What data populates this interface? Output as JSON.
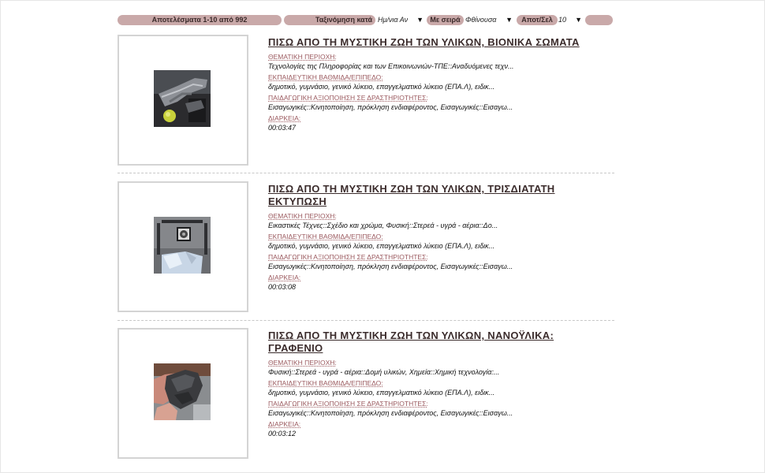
{
  "controls": {
    "results_label": "Αποτελέσματα 1-10 από 992",
    "sort_label": "Ταξινόμηση κατά",
    "sort_value": "Ημ/νια Αν",
    "order_label": "Με σειρά",
    "order_value": "Φθίνουσα",
    "perpage_label": "Αποτ/Σελ",
    "perpage_value": "10",
    "arrow": "▼"
  },
  "labels": {
    "subject": "ΘΕΜΑΤΙΚΗ ΠΕΡΙΟΧΗ:",
    "level": "ΕΚΠΑΙΔΕΥΤΙΚΗ ΒΑΘΜΙΔΑ/ΕΠΙΠΕΔΟ:",
    "use": "ΠΑΙΔΑΓΩΓΙΚΗ ΑΞΙΟΠΟΙΗΣΗ ΣΕ ΔΡΑΣΤΗΡΙΟΤΗΤΕΣ:",
    "duration": "ΔΙΑΡΚΕΙΑ:"
  },
  "results": [
    {
      "title": "ΠΙΣΩ ΑΠΟ ΤΗ ΜΥΣΤΙΚΗ ΖΩΗ ΤΩΝ ΥΛΙΚΩΝ, ΒΙΟΝΙΚΑ ΣΩΜΑΤΑ",
      "subject": "Τεχνολογίες της Πληροφορίας και των Επικοινωνιών-ΤΠΕ::Αναδυόμενες τεχν...",
      "level": "δημοτικό, γυμνάσιο, γενικό λύκειο, επαγγελματικό λύκειο (ΕΠΑ.Λ), ειδικ...",
      "use": "Εισαγωγικές::Κινητοποίηση, πρόκληση ενδιαφέροντος, Εισαγωγικές::Εισαγω...",
      "duration": "00:03:47",
      "thumb_icon": "robotic-hand-thumbnail"
    },
    {
      "title": "ΠΙΣΩ ΑΠΟ ΤΗ ΜΥΣΤΙΚΗ ΖΩΗ ΤΩΝ ΥΛΙΚΩΝ, ΤΡΙΣΔΙΑΤΑΤΗ ΕΚΤΥΠΩΣΗ",
      "subject": "Εικαστικές Τέχνες::Σχέδιο και χρώμα, Φυσική::Στερεά - υγρά - αέρια::Δο...",
      "level": "δημοτικό, γυμνάσιο, γενικό λύκειο, επαγγελματικό λύκειο (ΕΠΑ.Λ), ειδικ...",
      "use": "Εισαγωγικές::Κινητοποίηση, πρόκληση ενδιαφέροντος, Εισαγωγικές::Εισαγω...",
      "duration": "00:03:08",
      "thumb_icon": "3d-printer-thumbnail"
    },
    {
      "title": "ΠΙΣΩ ΑΠΟ ΤΗ ΜΥΣΤΙΚΗ ΖΩΗ ΤΩΝ ΥΛΙΚΩΝ, ΝΑΝΟΫΛΙΚΑ: ΓΡΑΦΕΝΙΟ",
      "subject": "Φυσική::Στερεά - υγρά - αέρια::Δομή υλικών, Χημεία::Χημική τεχνολογία:...",
      "level": "δημοτικό, γυμνάσιο, γενικό λύκειο, επαγγελματικό λύκειο (ΕΠΑ.Λ), ειδικ...",
      "use": "Εισαγωγικές::Κινητοποίηση, πρόκληση ενδιαφέροντος, Εισαγωγικές::Εισαγω...",
      "duration": "00:03:12",
      "thumb_icon": "graphite-rock-thumbnail"
    }
  ]
}
